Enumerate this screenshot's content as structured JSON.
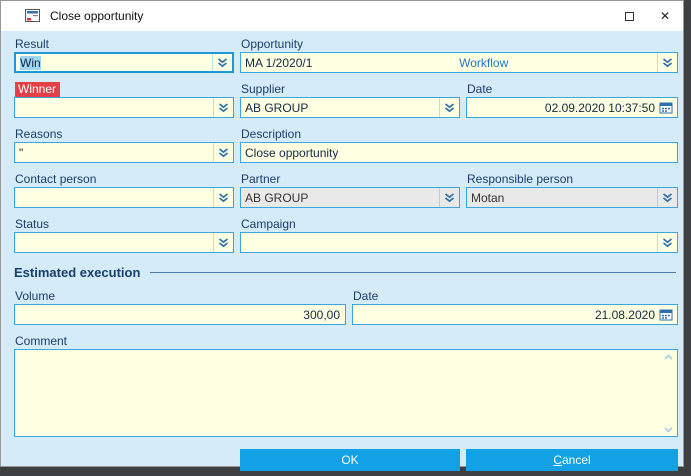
{
  "window": {
    "title": "Close opportunity"
  },
  "icons": {
    "close_glyph": "✕"
  },
  "form": {
    "result": {
      "label": "Result",
      "value": "Win"
    },
    "opportunity": {
      "label": "Opportunity",
      "value": "MA 1/2020/1",
      "workflow": "Workflow"
    },
    "winner": {
      "label": "Winner",
      "value": ""
    },
    "supplier": {
      "label": "Supplier",
      "value": "AB GROUP"
    },
    "date": {
      "label": "Date",
      "value": "02.09.2020 10:37:50"
    },
    "reasons": {
      "label": "Reasons",
      "value": "\""
    },
    "description": {
      "label": "Description",
      "value": "Close opportunity"
    },
    "contact_person": {
      "label": "Contact person",
      "value": ""
    },
    "partner": {
      "label": "Partner",
      "value": "AB GROUP"
    },
    "responsible_person": {
      "label": "Responsible person",
      "value": "Motan"
    },
    "status": {
      "label": "Status",
      "value": ""
    },
    "campaign": {
      "label": "Campaign",
      "value": ""
    }
  },
  "estimated": {
    "section_title": "Estimated execution",
    "volume": {
      "label": "Volume",
      "value": "300,00"
    },
    "date": {
      "label": "Date",
      "value": "21.08.2020"
    },
    "comment": {
      "label": "Comment",
      "value": ""
    }
  },
  "buttons": {
    "ok": "OK",
    "cancel_accel": "C",
    "cancel_rest": "ancel"
  },
  "colors": {
    "accent_blue": "#12a1e4",
    "dialog_bg": "#d5ebf7",
    "field_bg": "#ffffe1",
    "field_border": "#3ba6dd",
    "label_text": "#1b3d6d",
    "winner_badge_bg": "#e4404a",
    "disabled_field_bg": "#e9e9e9",
    "link_blue": "#2078c8"
  }
}
